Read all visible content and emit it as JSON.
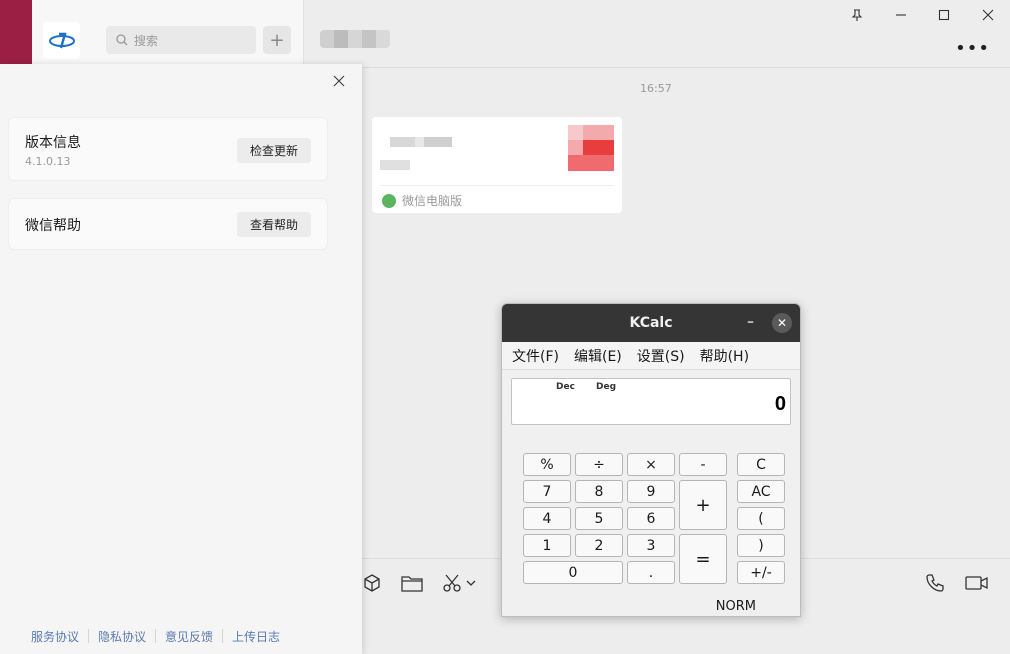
{
  "search": {
    "placeholder": "搜索"
  },
  "chat": {
    "time": "16:57",
    "card_source": "微信电脑版"
  },
  "about": {
    "version_title": "版本信息",
    "version": "4.1.0.13",
    "update_button": "检查更新",
    "help_title": "微信帮助",
    "help_button": "查看帮助",
    "links": [
      "服务协议",
      "隐私协议",
      "意见反馈",
      "上传日志"
    ]
  },
  "kcalc": {
    "title": "KCalc",
    "menu": [
      "文件(F)",
      "编辑(E)",
      "设置(S)",
      "帮助(H)"
    ],
    "display": {
      "base": "Dec",
      "angle": "Deg",
      "value": "0"
    },
    "keys": {
      "percent": "%",
      "divide": "÷",
      "multiply": "×",
      "minus": "-",
      "seven": "7",
      "eight": "8",
      "nine": "9",
      "plus": "+",
      "four": "4",
      "five": "5",
      "six": "6",
      "one": "1",
      "two": "2",
      "three": "3",
      "equals": "=",
      "zero": "0",
      "dot": ".",
      "clear": "C",
      "all_clear": "AC",
      "lparen": "(",
      "rparen": ")",
      "negate": "+/-"
    },
    "status": "NORM"
  }
}
